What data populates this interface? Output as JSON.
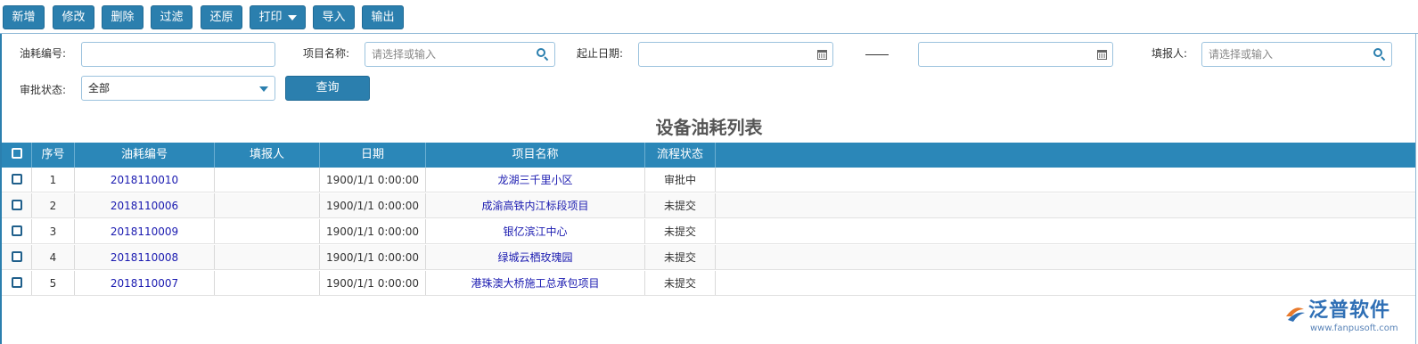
{
  "toolbar": {
    "buttons": [
      "新增",
      "修改",
      "删除",
      "过滤",
      "还原",
      "打印",
      "导入",
      "输出"
    ]
  },
  "filters": {
    "code_label": "油耗编号:",
    "code_value": "",
    "project_label": "项目名称:",
    "project_placeholder": "请选择或输入",
    "date_label": "起止日期:",
    "date_start": "",
    "date_end": "",
    "reporter_label": "填报人:",
    "reporter_placeholder": "请选择或输入",
    "status_label": "审批状态:",
    "status_value": "全部",
    "query_label": "查询"
  },
  "page_title": "设备油耗列表",
  "table": {
    "headers": [
      "序号",
      "油耗编号",
      "填报人",
      "日期",
      "项目名称",
      "流程状态"
    ],
    "rows": [
      {
        "no": "1",
        "code": "2018110010",
        "reporter": "",
        "date": "1900/1/1 0:00:00",
        "project": "龙湖三千里小区",
        "status": "审批中"
      },
      {
        "no": "2",
        "code": "2018110006",
        "reporter": "",
        "date": "1900/1/1 0:00:00",
        "project": "成渝高铁内江标段项目",
        "status": "未提交"
      },
      {
        "no": "3",
        "code": "2018110009",
        "reporter": "",
        "date": "1900/1/1 0:00:00",
        "project": "银亿滨江中心",
        "status": "未提交"
      },
      {
        "no": "4",
        "code": "2018110008",
        "reporter": "",
        "date": "1900/1/1 0:00:00",
        "project": "绿城云栖玫瑰园",
        "status": "未提交"
      },
      {
        "no": "5",
        "code": "2018110007",
        "reporter": "",
        "date": "1900/1/1 0:00:00",
        "project": "港珠澳大桥施工总承包项目",
        "status": "未提交"
      }
    ]
  },
  "logo": {
    "brand": "泛普软件",
    "url": "www.fanpusoft.com"
  },
  "colors": {
    "accent": "#2b7fae",
    "header": "#2b87b8",
    "link": "#1a1ab0"
  }
}
